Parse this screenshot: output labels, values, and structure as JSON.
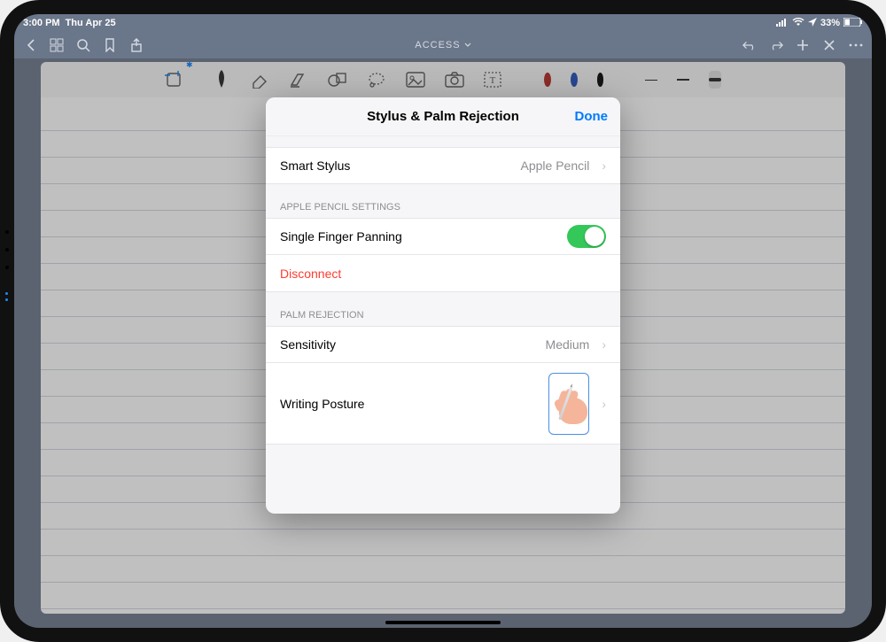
{
  "status": {
    "time": "3:00 PM",
    "date": "Thu Apr 25",
    "battery_pct": "33%"
  },
  "nav": {
    "title": "ACCESS"
  },
  "popover": {
    "title": "Stylus & Palm Rejection",
    "done": "Done",
    "smart_stylus_label": "Smart Stylus",
    "smart_stylus_value": "Apple Pencil",
    "section_pencil": "APPLE PENCIL SETTINGS",
    "single_finger_label": "Single Finger Panning",
    "disconnect": "Disconnect",
    "section_palm": "PALM REJECTION",
    "sensitivity_label": "Sensitivity",
    "sensitivity_value": "Medium",
    "posture_label": "Writing Posture"
  },
  "colors": {
    "red": "#b3261e",
    "blue": "#1e4db7",
    "black": "#000000"
  }
}
